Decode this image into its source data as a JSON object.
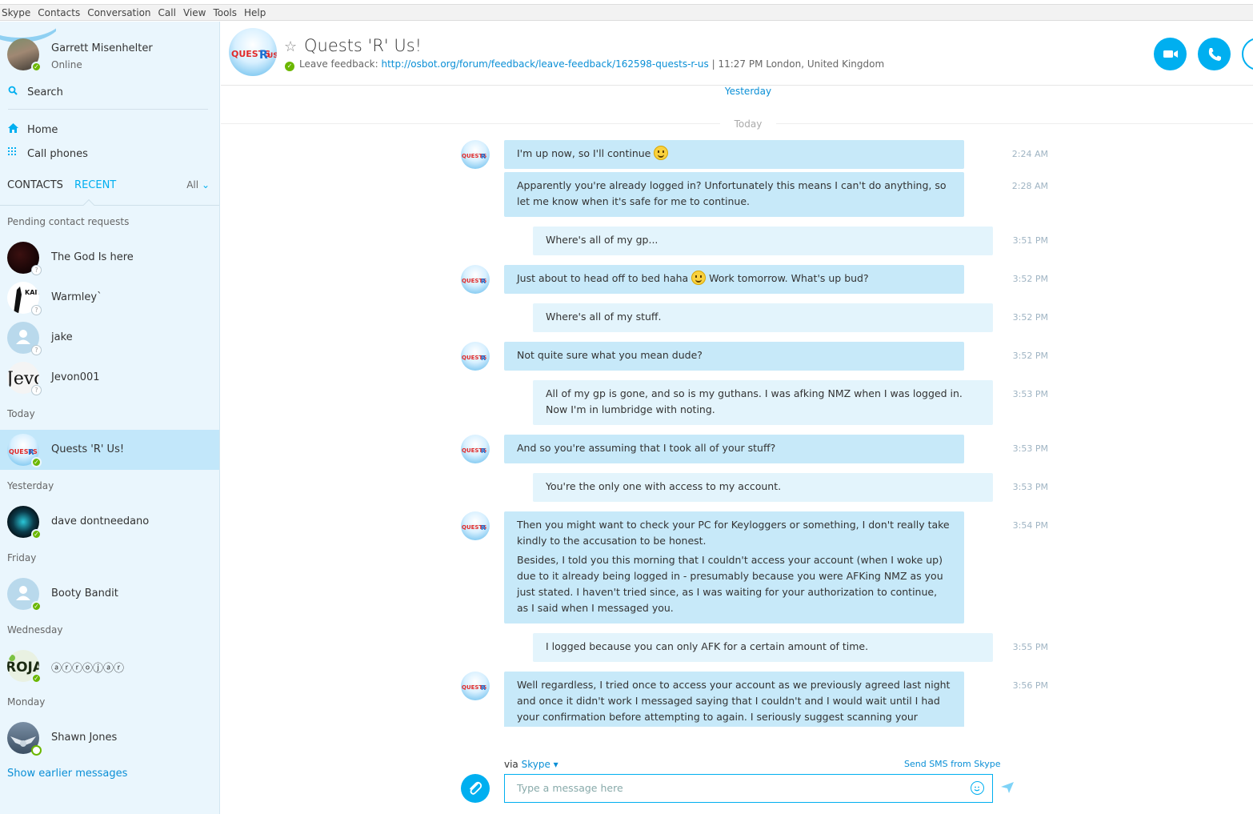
{
  "menu": [
    "Skype",
    "Contacts",
    "Conversation",
    "Call",
    "View",
    "Tools",
    "Help"
  ],
  "profile": {
    "name": "Garrett Misenhelter",
    "status": "Online"
  },
  "search": {
    "label": "Search"
  },
  "nav": {
    "home": "Home",
    "call_phones": "Call phones"
  },
  "tabs": {
    "contacts": "CONTACTS",
    "recent": "RECENT",
    "filter": "All"
  },
  "sections": {
    "pending": "Pending contact requests",
    "today": "Today",
    "yesterday": "Yesterday",
    "friday": "Friday",
    "wednesday": "Wednesday",
    "monday": "Monday"
  },
  "contacts": [
    {
      "name": "The God Is here",
      "status": "pending"
    },
    {
      "name": "Warmley`",
      "status": "pending"
    },
    {
      "name": "jake",
      "status": "pending"
    },
    {
      "name": "Jevon001",
      "status": "pending"
    },
    {
      "name": "Quests 'R' Us!",
      "status": "online"
    },
    {
      "name": "dave dontneedano",
      "status": "online"
    },
    {
      "name": "Booty Bandit",
      "status": "online"
    },
    {
      "name": "ⓐⓡⓡⓞⓙⓐⓡ",
      "status": "online"
    },
    {
      "name": "Shawn Jones",
      "status": "away"
    }
  ],
  "show_earlier": "Show earlier messages",
  "chat": {
    "title": "Quests 'R' Us!",
    "mood_prefix": "Leave feedback: ",
    "mood_link": "http://osbot.org/forum/feedback/leave-feedback/162598-quests-r-us",
    "mood_suffix": " |  11:27 PM London, United Kingdom",
    "sep_yesterday": "Yesterday",
    "sep_today": "Today"
  },
  "messages": [
    {
      "dir": "in",
      "text": "I'm up now, so I'll continue ",
      "emoji": true,
      "time": "2:24 AM"
    },
    {
      "dir": "in",
      "text": "Apparently you're already logged in? Unfortunately this means I can't do anything, so let me know when it's safe for me to continue.",
      "time": "2:28 AM"
    },
    {
      "dir": "out",
      "text": "Where's all of my gp...",
      "time": "3:51 PM"
    },
    {
      "dir": "in",
      "text": "Just about to head off to bed haha ",
      "emoji": true,
      "text_after": " Work tomorrow. What's up bud?",
      "time": "3:52 PM"
    },
    {
      "dir": "out",
      "text": "Where's all of my stuff.",
      "time": "3:52 PM"
    },
    {
      "dir": "in",
      "text": "Not quite sure what you mean dude?",
      "time": "3:52 PM"
    },
    {
      "dir": "out",
      "text": "All of my gp is gone, and so is my guthans. I was afking NMZ when I was logged in. Now I'm in lumbridge with noting.",
      "time": "3:53 PM"
    },
    {
      "dir": "in",
      "text": "And so you're assuming that I took all of your stuff?",
      "time": "3:53 PM"
    },
    {
      "dir": "out",
      "text": "You're the only one with access to my account.",
      "time": "3:53 PM"
    },
    {
      "dir": "in",
      "text": "Then you might want to check your PC for Keyloggers or something, I don't really take kindly to the accusation to be honest.",
      "text2": "Besides, I told you this morning that I couldn't access your account (when I woke up) due to it already being logged in - presumably because you were AFKing NMZ as you just stated. I haven't tried since, as I was waiting for your authorization to continue, as I said when I messaged you.",
      "time": "3:54 PM"
    },
    {
      "dir": "out",
      "text": "I logged because you can only AFK for a certain amount of time.",
      "time": "3:55 PM"
    },
    {
      "dir": "in",
      "text": "Well regardless, I tried once to access your account as we previously agreed last night and once it didn't work I messaged saying that I couldn't and I would wait until I had your confirmation before attempting to again. I seriously suggest scanning your computer for",
      "time": "3:56 PM"
    }
  ],
  "compose": {
    "via_prefix": "via ",
    "via_service": "Skype",
    "sms_link": "Send SMS from Skype",
    "placeholder": "Type a message here"
  },
  "colors": {
    "accent": "#00aff0",
    "online": "#6bb700",
    "bubble_in": "#c7e9f9",
    "bubble_out": "#e3f4fc",
    "sidebar_bg": "#eaf6fd"
  }
}
